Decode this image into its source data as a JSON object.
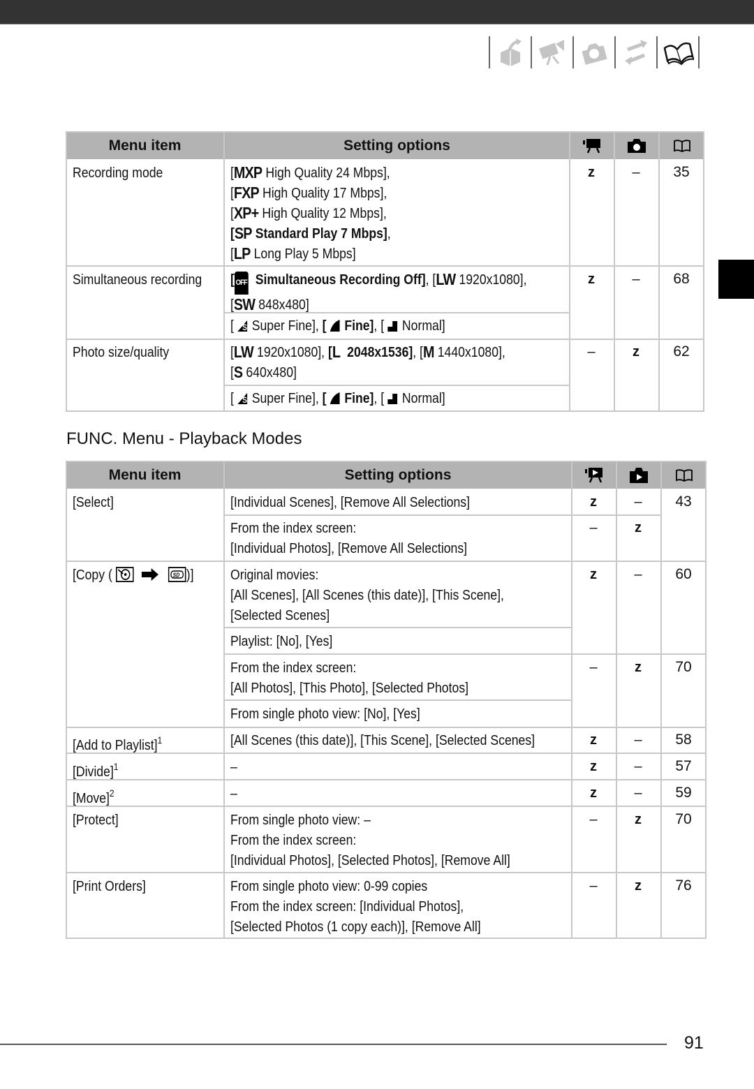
{
  "page": {
    "number": "91",
    "nav_icons": [
      "introduction-icon",
      "movies-icon",
      "photos-icon",
      "external-connections-icon",
      "additional-info-icon"
    ]
  },
  "table1": {
    "headers": {
      "menu_item": "Menu item",
      "setting_options": "Setting options",
      "col_movie": "movie-mode-icon",
      "col_photo": "photo-mode-icon",
      "col_page": "page-reference-icon"
    },
    "rows": [
      {
        "menu_item": "Recording mode",
        "options": [
          {
            "icon": "MXP",
            "text": "High Quality 24 Mbps],",
            "bold": false
          },
          {
            "icon": "FXP",
            "text": "High Quality 17 Mbps],",
            "bold": false
          },
          {
            "icon": "XP+",
            "text": "High Quality 12 Mbps],",
            "bold": false
          },
          {
            "icon": "SP",
            "text": "Standard Play 7 Mbps]",
            "suffix": ",",
            "bold": true
          },
          {
            "icon": "LP",
            "text": "Long Play 5 Mbps]",
            "bold": false
          }
        ],
        "movie": "z",
        "photo": "–",
        "page": "35"
      },
      {
        "menu_item": "Simultaneous recording",
        "options_line1": {
          "icon": "OFF",
          "bold_text": "Simultaneous Recording Off]",
          "rest_icon": "LW",
          "rest_text": "1920x1080],"
        },
        "options_line2": {
          "icon": "SW",
          "text": "848x480]"
        },
        "quality": {
          "superfine": "Super Fine],",
          "fine": "Fine]",
          "normal": "Normal]"
        },
        "movie": "z",
        "photo": "–",
        "page": "68"
      },
      {
        "menu_item": "Photo size/quality",
        "options_line1": {
          "lw_icon": "LW",
          "lw_text": "1920x1080],",
          "l_icon": "L",
          "l_text": "2048x1536]",
          "m_icon": "M",
          "m_text": "1440x1080],"
        },
        "options_line2": {
          "icon": "S",
          "text": "640x480]"
        },
        "quality": {
          "superfine": "Super Fine],",
          "fine": "Fine]",
          "normal": "Normal]"
        },
        "movie": "–",
        "photo": "z",
        "page": "62"
      }
    ]
  },
  "section2_title": "FUNC. Menu - Playback Modes",
  "table2": {
    "headers": {
      "menu_item": "Menu item",
      "setting_options": "Setting options",
      "col_movie": "movie-playback-icon",
      "col_photo": "photo-playback-icon",
      "col_page": "page-reference-icon"
    },
    "rows": [
      {
        "menu_item": "[Select]",
        "sub": [
          {
            "lines": [
              "[Individual Scenes], [Remove All Selections]"
            ],
            "movie": "z",
            "photo": "–"
          },
          {
            "lines": [
              "From the index screen:",
              "[Individual Photos], [Remove All Selections]"
            ],
            "movie": "–",
            "photo": "z"
          }
        ],
        "page": "43"
      },
      {
        "menu_item_prefix": "[Copy (",
        "menu_item_suffix": ")]",
        "sub": [
          {
            "lines": [
              "Original movies:",
              "[All Scenes], [All Scenes (this date)], [This Scene],",
              "[Selected Scenes]"
            ],
            "movie": "z",
            "photo": "–",
            "page": "60"
          },
          {
            "lines": [
              "Playlist: [No], [Yes]"
            ]
          },
          {
            "lines": [
              "From the index screen:",
              "[All Photos], [This Photo], [Selected Photos]"
            ],
            "movie": "–",
            "photo": "z",
            "page": "70"
          },
          {
            "lines": [
              "From single photo view: [No], [Yes]"
            ]
          }
        ]
      },
      {
        "menu_item": "[Add to Playlist]",
        "footnote": "1",
        "lines": [
          "[All Scenes (this date)], [This Scene], [Selected Scenes]"
        ],
        "movie": "z",
        "photo": "–",
        "page": "58"
      },
      {
        "menu_item": "[Divide]",
        "footnote": "1",
        "lines": [
          "–"
        ],
        "movie": "z",
        "photo": "–",
        "page": "57"
      },
      {
        "menu_item": "[Move]",
        "footnote": "2",
        "lines": [
          "–"
        ],
        "movie": "z",
        "photo": "–",
        "page": "59"
      },
      {
        "menu_item": "[Protect]",
        "lines": [
          "From single photo view: –",
          "From the index screen:",
          "[Individual Photos], [Selected Photos], [Remove All]"
        ],
        "movie": "–",
        "photo": "z",
        "page": "70"
      },
      {
        "menu_item": "[Print Orders]",
        "lines": [
          "From single photo view: 0-99 copies",
          "From the index screen: [Individual Photos],",
          "[Selected Photos (1 copy each)], [Remove All]"
        ],
        "movie": "–",
        "photo": "z",
        "page": "76"
      }
    ]
  }
}
